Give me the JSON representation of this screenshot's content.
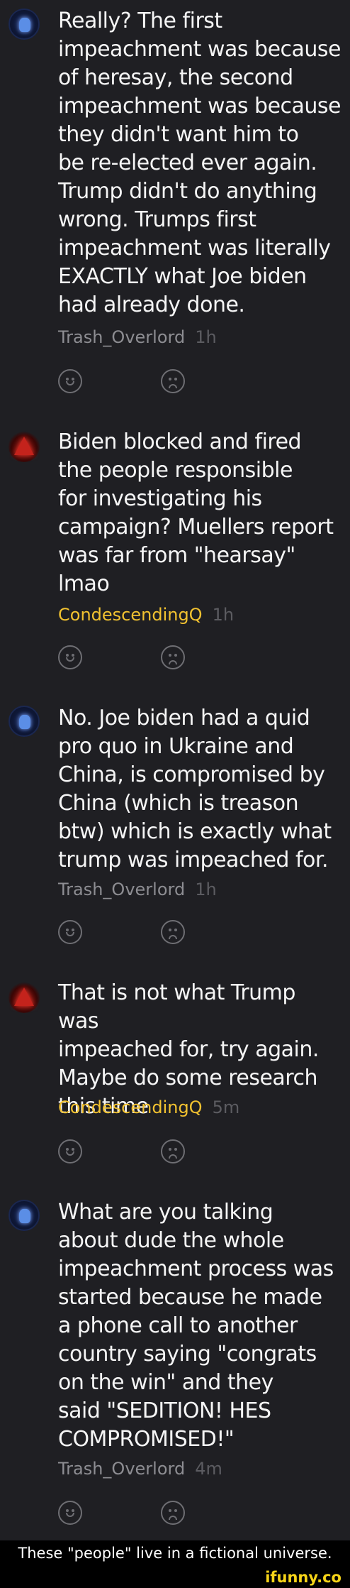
{
  "comments": [
    {
      "text": "Really? The first\nimpeachment was because\nof heresay, the second\nimpeachment was because\nthey didn't want him to\nbe re-elected ever again.\nTrump didn't do anything\nwrong. Trumps first\nimpeachment was literally\nEXACTLY what Joe biden\nhad already done.",
      "username": "Trash_Overlord",
      "time": "1h"
    },
    {
      "text": "Biden blocked and fired\nthe people responsible\nfor investigating his\ncampaign? Muellers report\nwas far from \"hearsay\"\nlmao",
      "username": "CondescendingQ",
      "time": "1h"
    },
    {
      "text": "No. Joe biden had a quid\npro quo in Ukraine and\nChina, is compromised by\nChina (which is treason\nbtw) which is exactly what\ntrump was impeached for.",
      "username": "Trash_Overlord",
      "time": "1h"
    },
    {
      "text": "That is not what Trump was\nimpeached for, try again.\nMaybe do some research\nthis time",
      "username": "CondescendingQ",
      "time": "5m"
    },
    {
      "text": "What are you talking\nabout dude the whole\nimpeachment process was\nstarted because he made\na phone call to another\ncountry saying \"congrats\non the win\" and they\nsaid \"SEDITION! HES\nCOMPROMISED!\"",
      "username": "Trash_Overlord",
      "time": "4m"
    }
  ],
  "caption": "These \"people\" live in a fictional universe.",
  "watermark": "ifunny.co",
  "colors": {
    "background": "#1f1f23",
    "username_gray": "#8d8d92",
    "username_gold": "#f2c230",
    "watermark": "#f6d418"
  },
  "icons": {
    "reaction_positive": "smile-face-icon",
    "reaction_negative": "frown-face-icon"
  }
}
